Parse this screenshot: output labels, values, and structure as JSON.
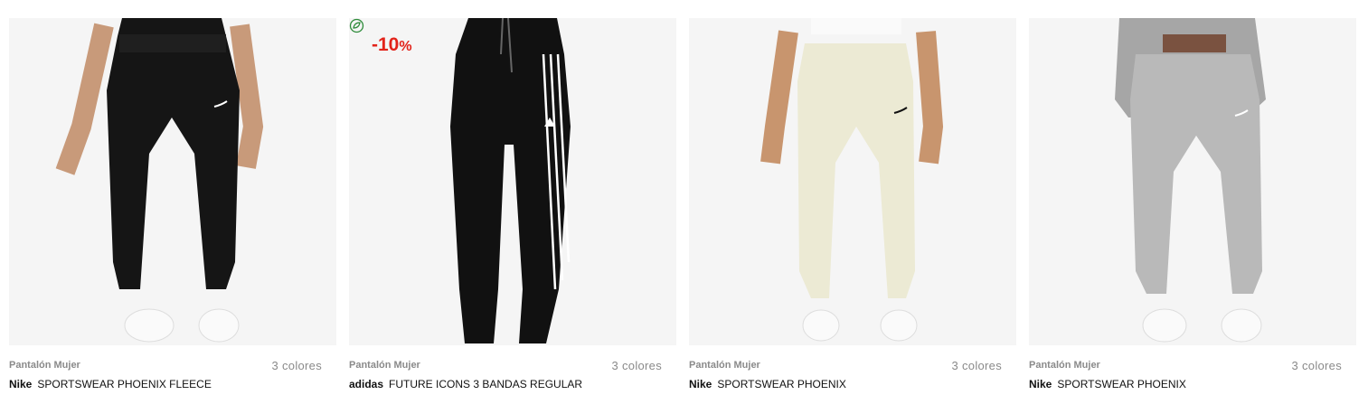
{
  "products": [
    {
      "category": "Pantalón Mujer",
      "colors": "3 colores",
      "brand": "Nike",
      "name": "SPORTSWEAR PHOENIX FLEECE",
      "discount": "",
      "eco": false,
      "pant_color": "#151515",
      "stripe": false,
      "logo": "nike",
      "logo_color": "#ffffff"
    },
    {
      "category": "Pantalón Mujer",
      "colors": "3 colores",
      "brand": "adidas",
      "name": "FUTURE ICONS 3 BANDAS REGULAR",
      "discount": "-10",
      "discount_unit": "%",
      "eco": true,
      "pant_color": "#111111",
      "stripe": true,
      "logo": "adidas",
      "logo_color": "#ffffff"
    },
    {
      "category": "Pantalón Mujer",
      "colors": "3 colores",
      "brand": "Nike",
      "name": "SPORTSWEAR PHOENIX",
      "discount": "",
      "eco": false,
      "pant_color": "#ecead4",
      "stripe": false,
      "logo": "nike",
      "logo_color": "#111111"
    },
    {
      "category": "Pantalón Mujer",
      "colors": "3 colores",
      "brand": "Nike",
      "name": "SPORTSWEAR PHOENIX",
      "discount": "",
      "eco": false,
      "pant_color": "#b9b9b9",
      "stripe": false,
      "logo": "nike",
      "logo_color": "#ffffff"
    }
  ],
  "colors": {
    "discount": "#e2231a",
    "meta_text": "#8a8a8a",
    "image_bg": "#f5f5f5",
    "eco_icon": "#2e8b3a"
  }
}
